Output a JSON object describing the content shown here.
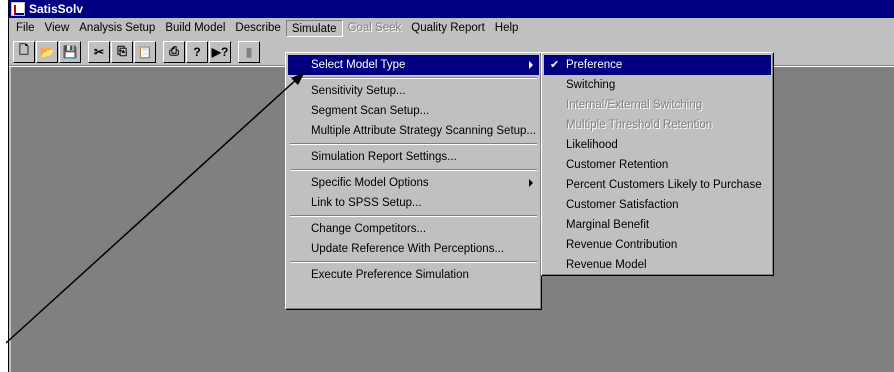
{
  "app": {
    "title": "SatisSolv"
  },
  "menubar": {
    "items": [
      {
        "label": "File",
        "state": "normal"
      },
      {
        "label": "View",
        "state": "normal"
      },
      {
        "label": "Analysis Setup",
        "state": "normal"
      },
      {
        "label": "Build Model",
        "state": "normal"
      },
      {
        "label": "Describe",
        "state": "normal"
      },
      {
        "label": "Simulate",
        "state": "open"
      },
      {
        "label": "Goal Seek",
        "state": "disabled"
      },
      {
        "label": "Quality Report",
        "state": "normal"
      },
      {
        "label": "Help",
        "state": "normal"
      }
    ]
  },
  "toolbar": {
    "buttons": [
      {
        "icon": "new-document-icon",
        "glyph": "🗋"
      },
      {
        "icon": "open-folder-icon",
        "glyph": "📂"
      },
      {
        "icon": "save-icon",
        "glyph": "💾"
      },
      {
        "icon": "cut-icon",
        "glyph": "✂"
      },
      {
        "icon": "copy-icon",
        "glyph": "⎘"
      },
      {
        "icon": "paste-icon",
        "glyph": "📋"
      },
      {
        "icon": "print-icon",
        "glyph": "⎙"
      },
      {
        "icon": "help-icon",
        "glyph": "?"
      },
      {
        "icon": "context-help-icon",
        "glyph": "▶?"
      },
      {
        "icon": "tool-icon",
        "glyph": "▮"
      }
    ]
  },
  "simulate_menu": {
    "groups": [
      [
        {
          "label": "Select Model Type",
          "submenu": true,
          "highlight": true
        }
      ],
      [
        {
          "label": "Sensitivity Setup..."
        },
        {
          "label": "Segment Scan Setup..."
        },
        {
          "label": "Multiple Attribute Strategy Scanning Setup..."
        }
      ],
      [
        {
          "label": "Simulation Report Settings..."
        }
      ],
      [
        {
          "label": "Specific Model Options",
          "submenu": true
        },
        {
          "label": "Link to SPSS Setup..."
        }
      ],
      [
        {
          "label": "Change Competitors..."
        },
        {
          "label": "Update Reference With Perceptions..."
        }
      ],
      [
        {
          "label": "Execute Preference Simulation"
        }
      ]
    ]
  },
  "model_type_submenu": {
    "items": [
      {
        "label": "Preference",
        "checked": true,
        "highlight": true
      },
      {
        "label": "Switching"
      },
      {
        "label": "Internal/External Switching",
        "disabled": true
      },
      {
        "label": "Multiple Threshold Retention",
        "disabled": true
      },
      {
        "label": "Likelihood"
      },
      {
        "label": "Customer Retention"
      },
      {
        "label": "Percent Customers Likely to Purchase"
      },
      {
        "label": "Customer Satisfaction"
      },
      {
        "label": "Marginal Benefit"
      },
      {
        "label": "Revenue Contribution"
      },
      {
        "label": "Revenue Model"
      }
    ]
  },
  "colors": {
    "title_bar": "#000080",
    "face": "#c0c0c0",
    "workspace": "#808080",
    "highlight": "#000080"
  }
}
